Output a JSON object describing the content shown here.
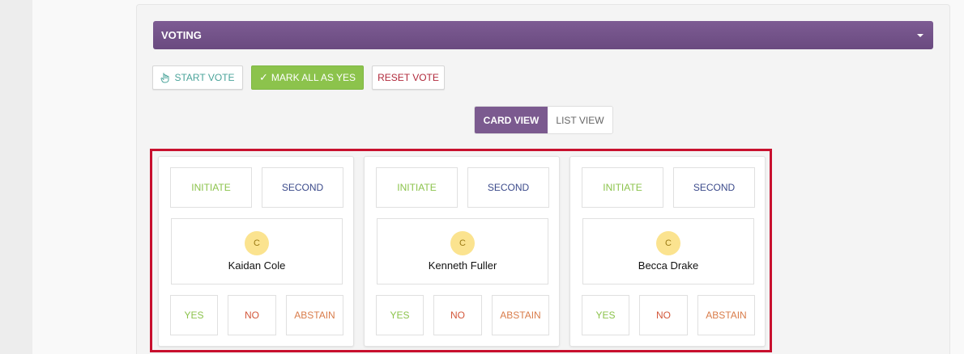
{
  "voting": {
    "header_title": "VOTING"
  },
  "toolbar": {
    "start_vote": "START VOTE",
    "mark_all_yes": "MARK ALL AS YES",
    "reset_vote": "RESET VOTE"
  },
  "view_toggle": {
    "card_view": "CARD VIEW",
    "list_view": "LIST VIEW",
    "selected": "CARD VIEW"
  },
  "cards": [
    {
      "initiate": "INITIATE",
      "second": "SECOND",
      "avatar_initial": "C",
      "name": "Kaidan Cole",
      "yes": "YES",
      "no": "NO",
      "abstain": "ABSTAIN"
    },
    {
      "initiate": "INITIATE",
      "second": "SECOND",
      "avatar_initial": "C",
      "name": "Kenneth Fuller",
      "yes": "YES",
      "no": "NO",
      "abstain": "ABSTAIN"
    },
    {
      "initiate": "INITIATE",
      "second": "SECOND",
      "avatar_initial": "C",
      "name": "Becca Drake",
      "yes": "YES",
      "no": "NO",
      "abstain": "ABSTAIN"
    }
  ],
  "colors": {
    "header_purple": "#6a4a80",
    "mark_green": "#8cc34c",
    "reset_red": "#b0283a",
    "highlight_red": "#c8102e",
    "second_blue": "#3b4a8b",
    "avatar_yellow": "#fbe38f"
  },
  "icons": {
    "start_vote": "hand-pointer-icon",
    "mark_all": "checkmark-icon",
    "header_toggle": "caret-down-icon"
  }
}
